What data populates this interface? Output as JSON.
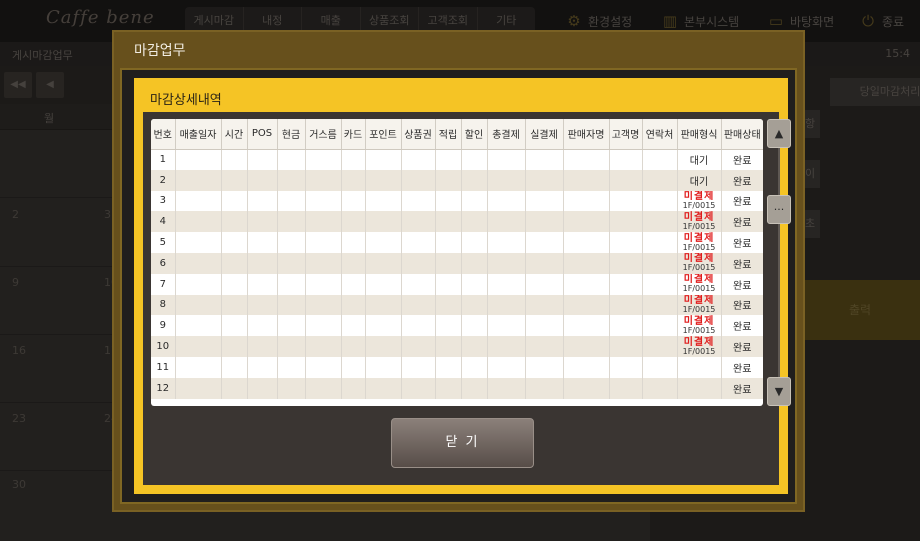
{
  "app": {
    "logo": "Caffe bene",
    "nav": [
      "게시마감",
      "내정",
      "매출",
      "상품조회",
      "고객조회",
      "기타"
    ],
    "top_buttons": [
      {
        "label": "환경설정",
        "icon": "gear-icon"
      },
      {
        "label": "본부시스템",
        "icon": "chart-icon"
      },
      {
        "label": "바탕화면",
        "icon": "monitor-icon"
      },
      {
        "label": "종료",
        "icon": "power-icon"
      }
    ],
    "subbar_left": "게시마감업무",
    "subbar_right": "15:4",
    "calendar_header_day": "월",
    "calendar_days": [
      "2",
      "3",
      "9",
      "10",
      "16",
      "17",
      "23",
      "24",
      "30"
    ],
    "right_buttons": [
      "당일마감처리",
      "항",
      "이",
      "초",
      "출력"
    ]
  },
  "modal": {
    "title": "마감업무",
    "panel_title": "마감상세내역",
    "columns": [
      "번호",
      "매출일자",
      "시간",
      "POS",
      "현금",
      "거스름",
      "카드",
      "포인트",
      "상품권",
      "적립",
      "할인",
      "총결제",
      "실결제",
      "판매자명",
      "고객명",
      "연락처",
      "판매형식",
      "판매상태"
    ],
    "rows": [
      {
        "no": "1",
        "type": "대기",
        "type_sub": "",
        "status": "완료"
      },
      {
        "no": "2",
        "type": "대기",
        "type_sub": "",
        "status": "완료"
      },
      {
        "no": "3",
        "type": "미결제",
        "type_sub": "1F/0015",
        "status": "완료"
      },
      {
        "no": "4",
        "type": "미결제",
        "type_sub": "1F/0015",
        "status": "완료"
      },
      {
        "no": "5",
        "type": "미결제",
        "type_sub": "1F/0015",
        "status": "완료"
      },
      {
        "no": "6",
        "type": "미결제",
        "type_sub": "1F/0015",
        "status": "완료"
      },
      {
        "no": "7",
        "type": "미결제",
        "type_sub": "1F/0015",
        "status": "완료"
      },
      {
        "no": "8",
        "type": "미결제",
        "type_sub": "1F/0015",
        "status": "완료"
      },
      {
        "no": "9",
        "type": "미결제",
        "type_sub": "1F/0015",
        "status": "완료"
      },
      {
        "no": "10",
        "type": "미결제",
        "type_sub": "1F/0015",
        "status": "완료"
      },
      {
        "no": "11",
        "type": "",
        "type_sub": "",
        "status": "완료"
      },
      {
        "no": "12",
        "type": "",
        "type_sub": "",
        "status": "완료"
      }
    ],
    "scroll_up_label": "▲",
    "scroll_mid_label": "···",
    "scroll_down_label": "▼",
    "close_label": "닫 기",
    "colors": {
      "accent_gold": "#f5c425",
      "unpaid_red": "#e01c1c"
    }
  }
}
